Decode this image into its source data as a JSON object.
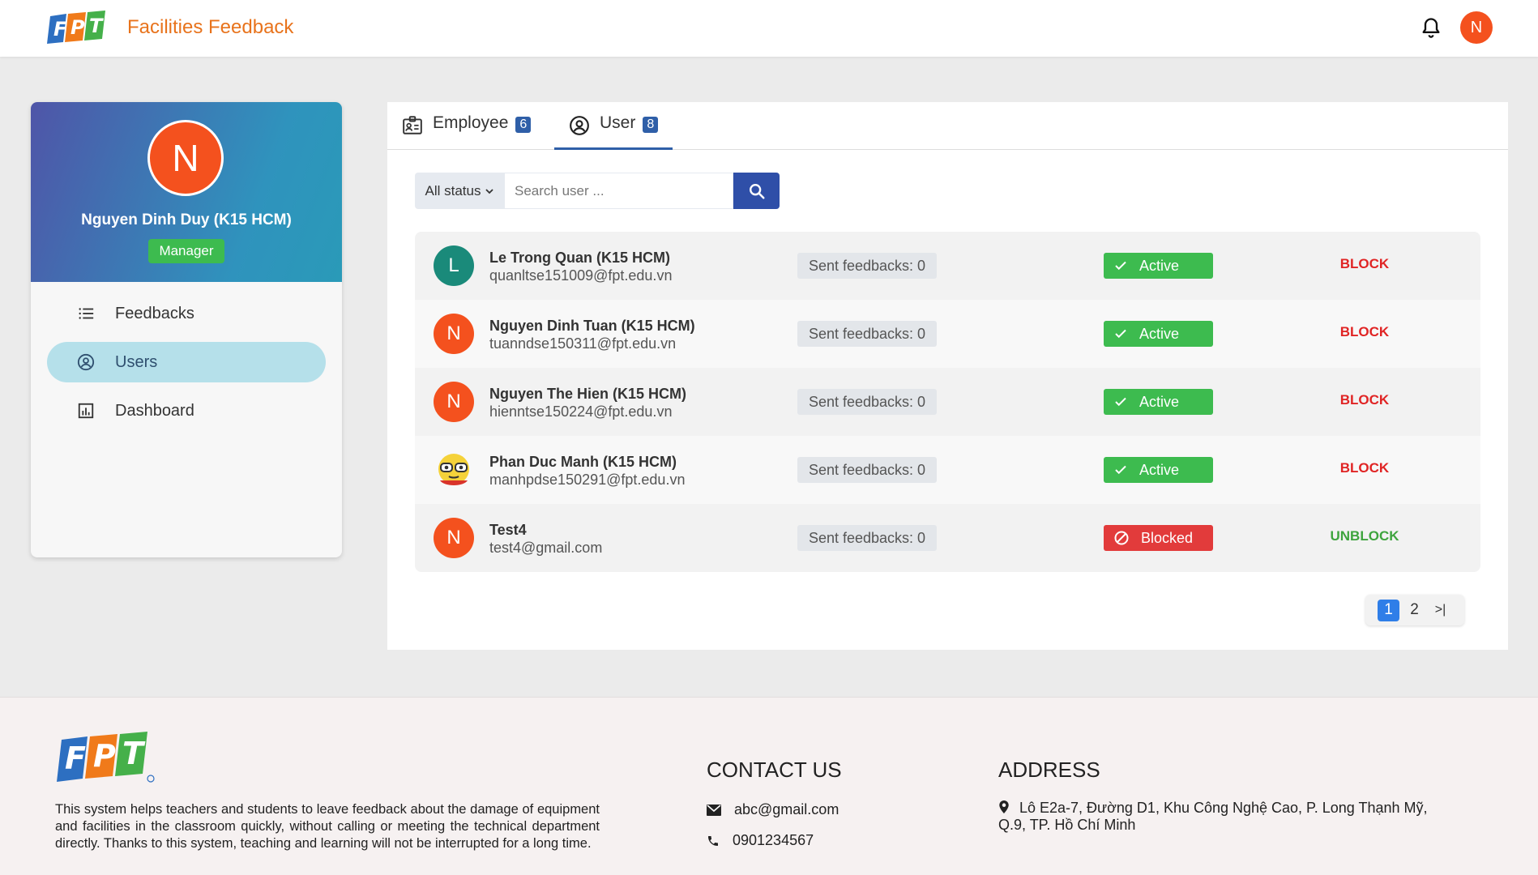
{
  "header": {
    "app_title": "Facilities Feedback",
    "avatar_initial": "N",
    "logo_text": "FPT"
  },
  "sidebar": {
    "avatar_initial": "N",
    "name": "Nguyen Dinh Duy (K15 HCM)",
    "role": "Manager",
    "menu": [
      {
        "label": "Feedbacks",
        "icon": "list-icon"
      },
      {
        "label": "Users",
        "icon": "user-circle-icon",
        "active": true
      },
      {
        "label": "Dashboard",
        "icon": "chart-icon"
      }
    ]
  },
  "tabs": [
    {
      "label": "Employee",
      "count": "6",
      "icon": "id-card-icon"
    },
    {
      "label": "User",
      "count": "8",
      "icon": "user-circle-icon",
      "active": true
    }
  ],
  "search": {
    "status_value": "All status",
    "placeholder": "Search user ..."
  },
  "users": [
    {
      "initial": "L",
      "avatar_color": "#1a8a7a",
      "name": "Le Trong Quan (K15 HCM)",
      "email": "quanltse151009@fpt.edu.vn",
      "feedbacks": "Sent feedbacks: 0",
      "status": "Active",
      "action": "BLOCK"
    },
    {
      "initial": "N",
      "avatar_color": "#f4511e",
      "name": "Nguyen Dinh Tuan (K15 HCM)",
      "email": "tuanndse150311@fpt.edu.vn",
      "feedbacks": "Sent feedbacks: 0",
      "status": "Active",
      "action": "BLOCK"
    },
    {
      "initial": "N",
      "avatar_color": "#f4511e",
      "name": "Nguyen The Hien (K15 HCM)",
      "email": "hienntse150224@fpt.edu.vn",
      "feedbacks": "Sent feedbacks: 0",
      "status": "Active",
      "action": "BLOCK"
    },
    {
      "initial": "",
      "avatar_color": "#f5d23a",
      "name": "Phan Duc Manh (K15 HCM)",
      "email": "manhpdse150291@fpt.edu.vn",
      "feedbacks": "Sent feedbacks: 0",
      "status": "Active",
      "action": "BLOCK"
    },
    {
      "initial": "N",
      "avatar_color": "#f4511e",
      "name": "Test4",
      "email": "test4@gmail.com",
      "feedbacks": "Sent feedbacks: 0",
      "status": "Blocked",
      "action": "UNBLOCK"
    }
  ],
  "pagination": {
    "pages": [
      "1",
      "2"
    ],
    "current": "1",
    "last_label": ">|"
  },
  "footer": {
    "description": "This system helps teachers and students to leave feedback about the damage of equipment and facilities in the classroom quickly, without calling or meeting the technical department directly. Thanks to this system, teaching and learning will not be interrupted for a long time.",
    "contact_title": "CONTACT US",
    "email": "abc@gmail.com",
    "phone": "0901234567",
    "address_title": "ADDRESS",
    "address": "Lô E2a-7, Đường D1, Khu Công Nghệ Cao, P. Long Thạnh Mỹ, Q.9, TP. Hồ Chí Minh"
  },
  "colors": {
    "accent_orange": "#e8731c",
    "primary_blue": "#2f4fa8",
    "active_green": "#3dbb4f",
    "blocked_red": "#e23b3b"
  }
}
